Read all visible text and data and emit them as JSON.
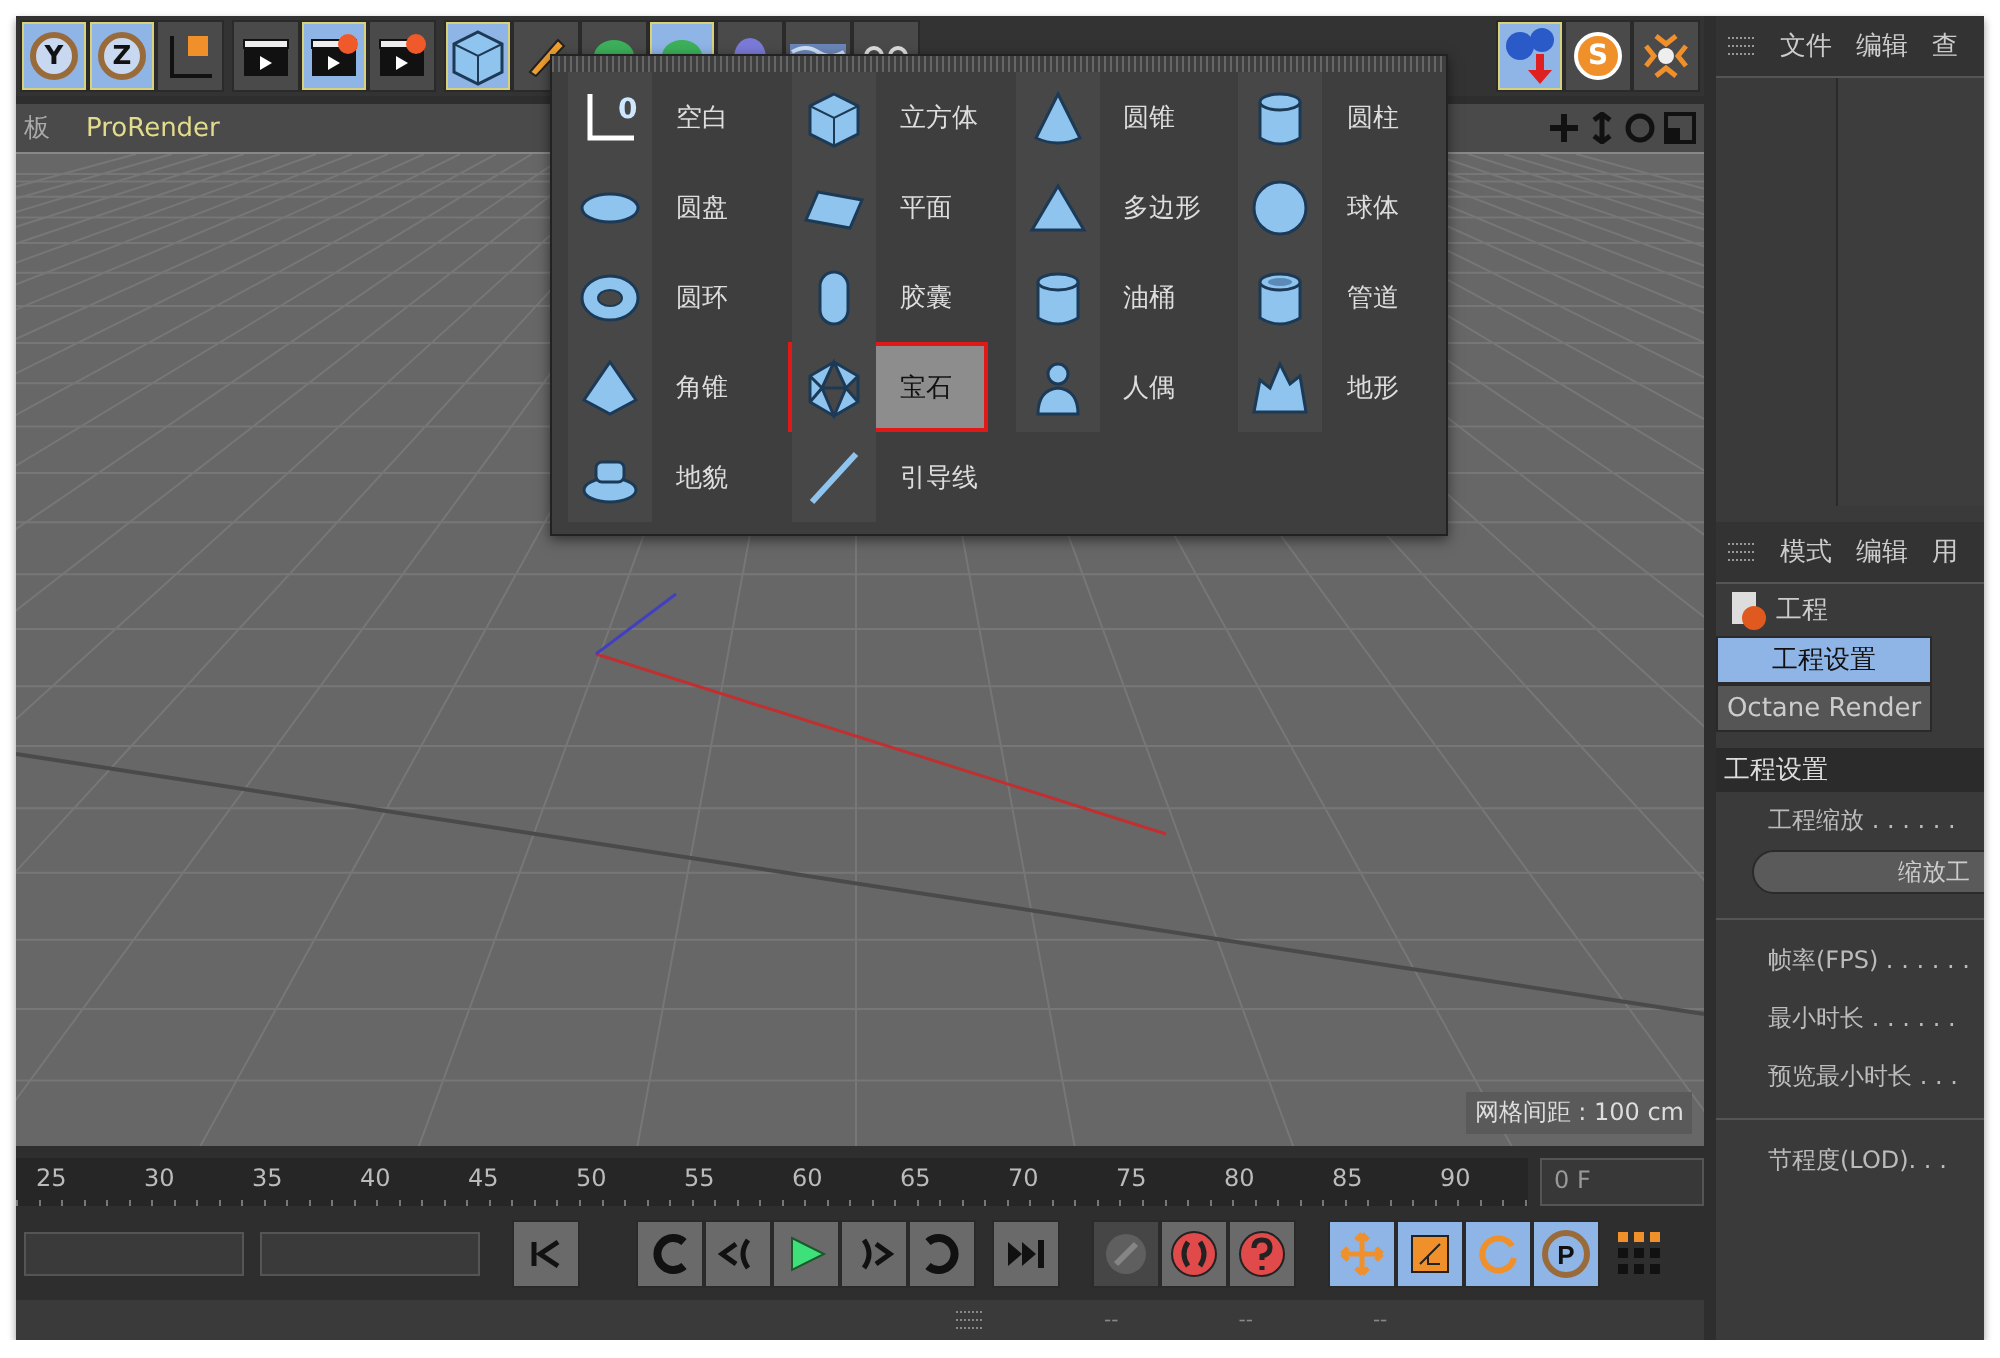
{
  "toolbar": {
    "tools": [
      {
        "kind": "axis",
        "label": "Y",
        "selected": true
      },
      {
        "kind": "axis",
        "label": "Z",
        "selected": true
      },
      {
        "kind": "coords",
        "selected": false
      },
      {
        "kind": "clapper",
        "selected": false
      },
      {
        "kind": "clapper-edit",
        "selected": true
      },
      {
        "kind": "clapper-gear",
        "selected": false
      },
      {
        "kind": "cube",
        "selected": true
      },
      {
        "kind": "pen",
        "selected": false
      },
      {
        "kind": "blob",
        "selected": false
      },
      {
        "kind": "blob",
        "selected": true
      },
      {
        "kind": "capsule",
        "selected": false
      },
      {
        "kind": "waves",
        "selected": false
      },
      {
        "kind": "dots",
        "selected": false
      }
    ],
    "right_tools": [
      {
        "kind": "spheres-arrow",
        "selected": true
      },
      {
        "kind": "s-badge",
        "label": "S",
        "selected": false
      },
      {
        "kind": "arrows-in",
        "selected": false
      }
    ]
  },
  "viewport": {
    "menu_tabs": [
      "板",
      "ProRender"
    ],
    "grid_spacing": "网格间距 : 100 cm"
  },
  "object_menu": {
    "items": [
      {
        "kind": "null",
        "label": "空白",
        "icon_text": "0",
        "selected": false
      },
      {
        "kind": "cube",
        "label": "立方体",
        "selected": false
      },
      {
        "kind": "cone",
        "label": "圆锥",
        "selected": false
      },
      {
        "kind": "cylinder",
        "label": "圆柱",
        "selected": false
      },
      {
        "kind": "disc",
        "label": "圆盘",
        "selected": false
      },
      {
        "kind": "plane",
        "label": "平面",
        "selected": false
      },
      {
        "kind": "polygon",
        "label": "多边形",
        "selected": false
      },
      {
        "kind": "sphere",
        "label": "球体",
        "selected": false
      },
      {
        "kind": "torus",
        "label": "圆环",
        "selected": false
      },
      {
        "kind": "capsule",
        "label": "胶囊",
        "selected": false
      },
      {
        "kind": "oiltank",
        "label": "油桶",
        "selected": false
      },
      {
        "kind": "tube",
        "label": "管道",
        "selected": false
      },
      {
        "kind": "pyramid",
        "label": "角锥",
        "selected": false
      },
      {
        "kind": "platonic",
        "label": "宝石",
        "selected": true
      },
      {
        "kind": "figure",
        "label": "人偶",
        "selected": false
      },
      {
        "kind": "landscape",
        "label": "地形",
        "selected": false
      },
      {
        "kind": "relief",
        "label": "地貌",
        "selected": false
      },
      {
        "kind": "guide",
        "label": "引导线",
        "selected": false
      }
    ]
  },
  "timeline": {
    "ticks": [
      "25",
      "30",
      "35",
      "40",
      "45",
      "50",
      "55",
      "60",
      "65",
      "70",
      "75",
      "80",
      "85",
      "90"
    ],
    "current_frame": "0 F"
  },
  "transport": [
    {
      "kind": "loop-back"
    },
    {
      "kind": "prev-key"
    },
    {
      "kind": "play"
    },
    {
      "kind": "next-key"
    },
    {
      "kind": "loop-forward"
    },
    {
      "kind": "to-end"
    }
  ],
  "key_tools": [
    {
      "kind": "key",
      "disabled": true
    },
    {
      "kind": "record",
      "disabled": false
    },
    {
      "kind": "help",
      "disabled": false
    }
  ],
  "transform_tools": [
    {
      "kind": "move",
      "selected": true
    },
    {
      "kind": "scale",
      "selected": true
    },
    {
      "kind": "rotate",
      "selected": true
    },
    {
      "kind": "param",
      "label": "P",
      "selected": true
    }
  ],
  "status_bar": {
    "marks": [
      "--",
      "--",
      "--"
    ]
  },
  "object_manager": {
    "menu": [
      "文件",
      "编辑",
      "查"
    ]
  },
  "attributes": {
    "menu": [
      "模式",
      "编辑",
      "用"
    ],
    "title": "工程",
    "tabs": [
      {
        "label": "工程设置",
        "selected": true
      },
      {
        "label": "Octane Render",
        "selected": false
      }
    ],
    "section": "工程设置",
    "rows": [
      {
        "kind": "label",
        "label": "工程缩放 . . . . . ."
      },
      {
        "kind": "button",
        "label": "缩放工"
      },
      {
        "kind": "divider"
      },
      {
        "kind": "label",
        "label": "帧率(FPS) . . . . . ."
      },
      {
        "kind": "label",
        "label": "最小时长 . . . . . ."
      },
      {
        "kind": "label",
        "label": "预览最小时长 . . ."
      },
      {
        "kind": "divider"
      },
      {
        "kind": "label",
        "label": "节程度(LOD). . ."
      }
    ]
  }
}
